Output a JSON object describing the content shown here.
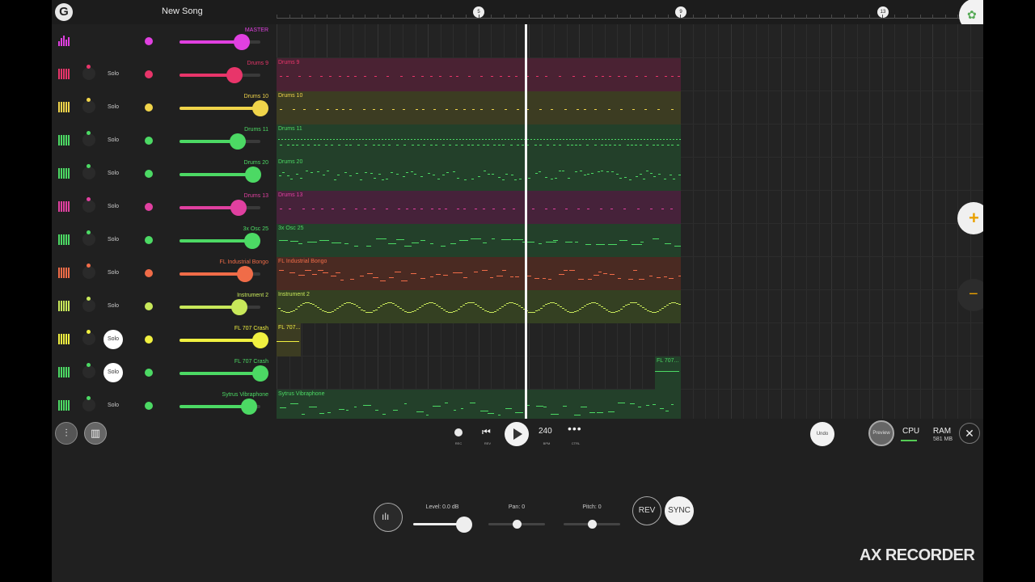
{
  "app": {
    "song_title": "New Song",
    "logo_letter": "G",
    "ruler_markers": [
      "5",
      "9",
      "13"
    ]
  },
  "channels": [
    {
      "name": "MASTER",
      "color": "#e040e0",
      "solo": "",
      "volume": 0.77,
      "solo_on": false,
      "master": true
    },
    {
      "name": "Drums 9",
      "color": "#e8356a",
      "solo": "Solo",
      "volume": 0.68,
      "solo_on": false
    },
    {
      "name": "Drums 10",
      "color": "#f0d44a",
      "solo": "Solo",
      "volume": 1.0,
      "solo_on": false
    },
    {
      "name": "Drums 11",
      "color": "#4cd964",
      "solo": "Solo",
      "volume": 0.72,
      "solo_on": false
    },
    {
      "name": "Drums 20",
      "color": "#4cd964",
      "solo": "Solo",
      "volume": 0.91,
      "solo_on": false
    },
    {
      "name": "Drums 13",
      "color": "#e040a0",
      "solo": "Solo",
      "volume": 0.73,
      "solo_on": false
    },
    {
      "name": "3x Osc 25",
      "color": "#4cd964",
      "solo": "Solo",
      "volume": 0.9,
      "solo_on": false
    },
    {
      "name": "FL Industrial Bongo",
      "color": "#f06c48",
      "solo": "Solo",
      "volume": 0.81,
      "solo_on": false
    },
    {
      "name": "Instrument 2",
      "color": "#c8e85a",
      "solo": "Solo",
      "volume": 0.74,
      "solo_on": false
    },
    {
      "name": "FL 707 Crash",
      "color": "#f0f040",
      "solo": "Solo",
      "volume": 1.0,
      "solo_on": true
    },
    {
      "name": "FL 707 Crash",
      "color": "#4cd964",
      "solo": "Solo",
      "volume": 1.0,
      "solo_on": true
    },
    {
      "name": "Sytrus Vibraphone",
      "color": "#4cd964",
      "solo": "Solo",
      "volume": 0.86,
      "solo_on": false
    }
  ],
  "clips": [
    null,
    {
      "name": "Drums 9",
      "color": "#e8356a",
      "bg": "#4a2233",
      "pattern": "sparse-dots"
    },
    {
      "name": "Drums 10",
      "color": "#f0d44a",
      "bg": "#3c3c22",
      "pattern": "sparse-dots"
    },
    {
      "name": "Drums 11",
      "color": "#4cd964",
      "bg": "#23402a",
      "pattern": "dense-dots"
    },
    {
      "name": "Drums 20",
      "color": "#4cd964",
      "bg": "#23402a",
      "pattern": "scattered"
    },
    {
      "name": "Drums 13",
      "color": "#e040a0",
      "bg": "#46223a",
      "pattern": "sparse-dots"
    },
    {
      "name": "3x Osc 25",
      "color": "#4cd964",
      "bg": "#23402a",
      "pattern": "dashes"
    },
    {
      "name": "FL Industrial Bongo",
      "color": "#f06c48",
      "bg": "#4a2a22",
      "pattern": "bongo"
    },
    {
      "name": "Instrument 2",
      "color": "#c8e85a",
      "bg": "#344022",
      "pattern": "zigzag"
    },
    {
      "name": "FL 707...",
      "color": "#f0f040",
      "bg": "#3c3c22",
      "pattern": "crash-start"
    },
    {
      "name": "FL 707...",
      "color": "#4cd964",
      "bg": "#23402a",
      "pattern": "crash-end"
    },
    {
      "name": "Sytrus Vibraphone",
      "color": "#4cd964",
      "bg": "#23402a",
      "pattern": "vibraphone"
    }
  ],
  "transport": {
    "rec_label": "REC",
    "rev_label": "REV",
    "bpm_value": "240",
    "bpm_label": "BPM",
    "ctrl_label": "CTRL",
    "undo_label": "Undo",
    "preview_label": "Preview",
    "cpu_label": "CPU",
    "ram_label": "RAM",
    "ram_value": "581 MB"
  },
  "sample_panel": {
    "level_label": "Level: 0.0 dB",
    "pan_label": "Pan: 0",
    "pitch_label": "Pitch: 0",
    "rev_button": "REV",
    "sync_button": "SYNC",
    "level": 0.9,
    "pan": 0.5,
    "pitch": 0.5
  },
  "watermark": "AX RECORDER"
}
